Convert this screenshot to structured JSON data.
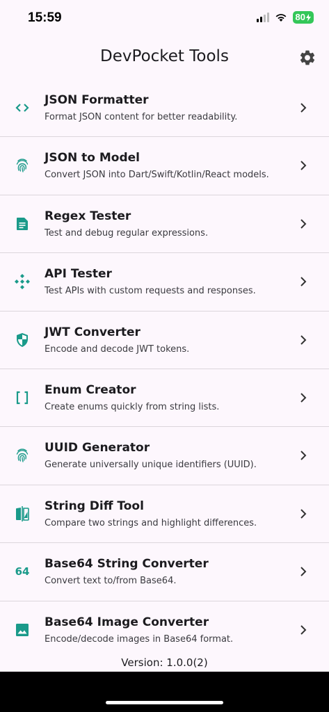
{
  "status_bar": {
    "time": "15:59",
    "battery": "80"
  },
  "app": {
    "title": "DevPocket Tools"
  },
  "tools": [
    {
      "title": "JSON Formatter",
      "subtitle": "Format JSON content for better readability."
    },
    {
      "title": "JSON to Model",
      "subtitle": "Convert JSON into Dart/Swift/Kotlin/React models."
    },
    {
      "title": "Regex Tester",
      "subtitle": "Test and debug regular expressions."
    },
    {
      "title": "API Tester",
      "subtitle": "Test APIs with custom requests and responses."
    },
    {
      "title": "JWT Converter",
      "subtitle": "Encode and decode JWT tokens."
    },
    {
      "title": "Enum Creator",
      "subtitle": "Create enums quickly from string lists."
    },
    {
      "title": "UUID Generator",
      "subtitle": "Generate universally unique identifiers (UUID)."
    },
    {
      "title": "String Diff Tool",
      "subtitle": "Compare two strings and highlight differences."
    },
    {
      "title": "Base64 String Converter",
      "subtitle": "Convert text to/from Base64.",
      "icon_text": "64"
    },
    {
      "title": "Base64 Image Converter",
      "subtitle": "Encode/decode images in Base64 format."
    }
  ],
  "footer": {
    "version": "Version: 1.0.0(2)"
  },
  "colors": {
    "accent": "#1a9a8a",
    "background": "#fdf7fd"
  }
}
